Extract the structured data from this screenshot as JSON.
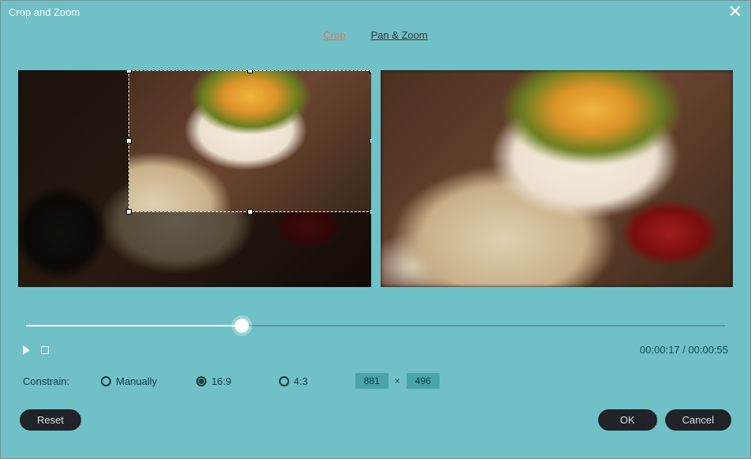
{
  "window": {
    "title": "Crop and Zoom"
  },
  "tabs": {
    "crop": "Crop",
    "panzoom": "Pan & Zoom",
    "active": "crop"
  },
  "timeline": {
    "position_percent": 30.9,
    "current": "00:00:17",
    "total": "00:00:55"
  },
  "constrain": {
    "label": "Constrain:",
    "options": {
      "manually": "Manually",
      "r169": "16:9",
      "r43": "4:3"
    },
    "selected": "r169",
    "width": "881",
    "height": "496",
    "sep": "×"
  },
  "buttons": {
    "reset": "Reset",
    "ok": "OK",
    "cancel": "Cancel"
  }
}
